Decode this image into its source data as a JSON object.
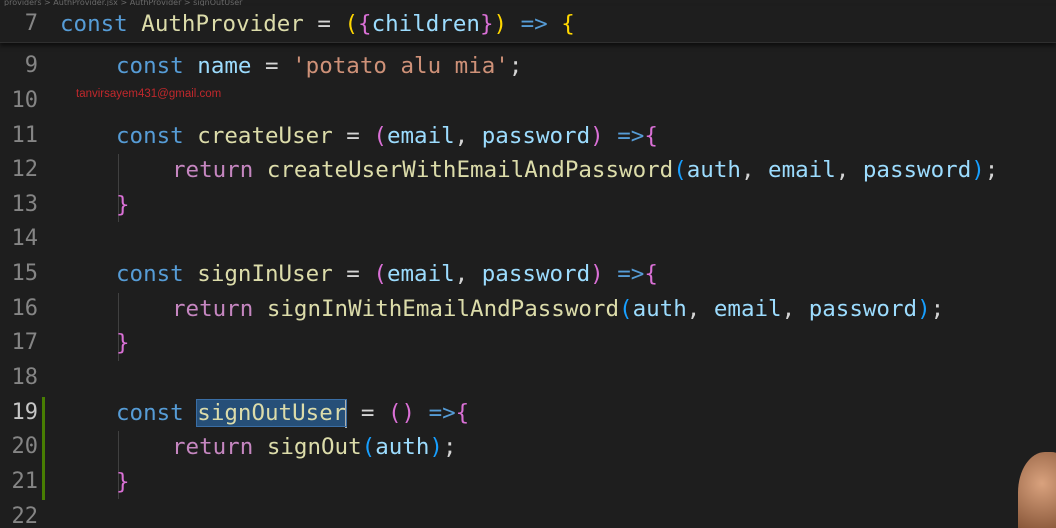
{
  "breadcrumb": "providers > AuthProvider.jsx > AuthProvider > signOutUser",
  "sticky_line": {
    "number": "7",
    "code": "const AuthProvider = ({children}) => {"
  },
  "watermark": "tanvirsayem431@gmail.com",
  "lines": [
    {
      "number": "9",
      "code": "const name = 'potato alu mia';"
    },
    {
      "number": "10",
      "code": ""
    },
    {
      "number": "11",
      "code": "const createUser = (email, password) =>{"
    },
    {
      "number": "12",
      "code": "return createUserWithEmailAndPassword(auth, email, password);"
    },
    {
      "number": "13",
      "code": "}"
    },
    {
      "number": "14",
      "code": ""
    },
    {
      "number": "15",
      "code": "const signInUser = (email, password) =>{"
    },
    {
      "number": "16",
      "code": "return signInWithEmailAndPassword(auth, email, password);"
    },
    {
      "number": "17",
      "code": "}"
    },
    {
      "number": "18",
      "code": ""
    },
    {
      "number": "19",
      "code": "const signOutUser = () =>{"
    },
    {
      "number": "20",
      "code": "return signOut(auth);"
    },
    {
      "number": "21",
      "code": "}"
    },
    {
      "number": "22",
      "code": ""
    }
  ],
  "selection": "signOutUser",
  "active_line": "19",
  "colors": {
    "background": "#1e1e1e",
    "keyword": "#569cd6",
    "control": "#c586c0",
    "variable": "#9cdcfe",
    "function": "#dcdcaa",
    "string": "#ce9178",
    "bracket_1": "#ffd700",
    "bracket_2": "#da70d6",
    "bracket_3": "#179fff",
    "selection": "#264f78",
    "git_added": "#487e02"
  }
}
